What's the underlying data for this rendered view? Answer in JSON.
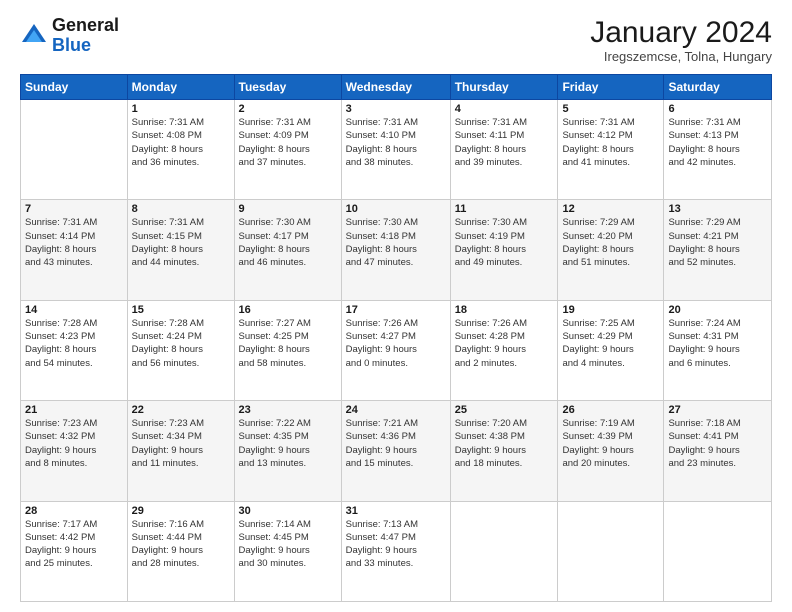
{
  "logo": {
    "general": "General",
    "blue": "Blue"
  },
  "header": {
    "month_year": "January 2024",
    "location": "Iregszemcse, Tolna, Hungary"
  },
  "days_of_week": [
    "Sunday",
    "Monday",
    "Tuesday",
    "Wednesday",
    "Thursday",
    "Friday",
    "Saturday"
  ],
  "weeks": [
    [
      {
        "day": "",
        "info": ""
      },
      {
        "day": "1",
        "info": "Sunrise: 7:31 AM\nSunset: 4:08 PM\nDaylight: 8 hours\nand 36 minutes."
      },
      {
        "day": "2",
        "info": "Sunrise: 7:31 AM\nSunset: 4:09 PM\nDaylight: 8 hours\nand 37 minutes."
      },
      {
        "day": "3",
        "info": "Sunrise: 7:31 AM\nSunset: 4:10 PM\nDaylight: 8 hours\nand 38 minutes."
      },
      {
        "day": "4",
        "info": "Sunrise: 7:31 AM\nSunset: 4:11 PM\nDaylight: 8 hours\nand 39 minutes."
      },
      {
        "day": "5",
        "info": "Sunrise: 7:31 AM\nSunset: 4:12 PM\nDaylight: 8 hours\nand 41 minutes."
      },
      {
        "day": "6",
        "info": "Sunrise: 7:31 AM\nSunset: 4:13 PM\nDaylight: 8 hours\nand 42 minutes."
      }
    ],
    [
      {
        "day": "7",
        "info": "Sunrise: 7:31 AM\nSunset: 4:14 PM\nDaylight: 8 hours\nand 43 minutes."
      },
      {
        "day": "8",
        "info": "Sunrise: 7:31 AM\nSunset: 4:15 PM\nDaylight: 8 hours\nand 44 minutes."
      },
      {
        "day": "9",
        "info": "Sunrise: 7:30 AM\nSunset: 4:17 PM\nDaylight: 8 hours\nand 46 minutes."
      },
      {
        "day": "10",
        "info": "Sunrise: 7:30 AM\nSunset: 4:18 PM\nDaylight: 8 hours\nand 47 minutes."
      },
      {
        "day": "11",
        "info": "Sunrise: 7:30 AM\nSunset: 4:19 PM\nDaylight: 8 hours\nand 49 minutes."
      },
      {
        "day": "12",
        "info": "Sunrise: 7:29 AM\nSunset: 4:20 PM\nDaylight: 8 hours\nand 51 minutes."
      },
      {
        "day": "13",
        "info": "Sunrise: 7:29 AM\nSunset: 4:21 PM\nDaylight: 8 hours\nand 52 minutes."
      }
    ],
    [
      {
        "day": "14",
        "info": "Sunrise: 7:28 AM\nSunset: 4:23 PM\nDaylight: 8 hours\nand 54 minutes."
      },
      {
        "day": "15",
        "info": "Sunrise: 7:28 AM\nSunset: 4:24 PM\nDaylight: 8 hours\nand 56 minutes."
      },
      {
        "day": "16",
        "info": "Sunrise: 7:27 AM\nSunset: 4:25 PM\nDaylight: 8 hours\nand 58 minutes."
      },
      {
        "day": "17",
        "info": "Sunrise: 7:26 AM\nSunset: 4:27 PM\nDaylight: 9 hours\nand 0 minutes."
      },
      {
        "day": "18",
        "info": "Sunrise: 7:26 AM\nSunset: 4:28 PM\nDaylight: 9 hours\nand 2 minutes."
      },
      {
        "day": "19",
        "info": "Sunrise: 7:25 AM\nSunset: 4:29 PM\nDaylight: 9 hours\nand 4 minutes."
      },
      {
        "day": "20",
        "info": "Sunrise: 7:24 AM\nSunset: 4:31 PM\nDaylight: 9 hours\nand 6 minutes."
      }
    ],
    [
      {
        "day": "21",
        "info": "Sunrise: 7:23 AM\nSunset: 4:32 PM\nDaylight: 9 hours\nand 8 minutes."
      },
      {
        "day": "22",
        "info": "Sunrise: 7:23 AM\nSunset: 4:34 PM\nDaylight: 9 hours\nand 11 minutes."
      },
      {
        "day": "23",
        "info": "Sunrise: 7:22 AM\nSunset: 4:35 PM\nDaylight: 9 hours\nand 13 minutes."
      },
      {
        "day": "24",
        "info": "Sunrise: 7:21 AM\nSunset: 4:36 PM\nDaylight: 9 hours\nand 15 minutes."
      },
      {
        "day": "25",
        "info": "Sunrise: 7:20 AM\nSunset: 4:38 PM\nDaylight: 9 hours\nand 18 minutes."
      },
      {
        "day": "26",
        "info": "Sunrise: 7:19 AM\nSunset: 4:39 PM\nDaylight: 9 hours\nand 20 minutes."
      },
      {
        "day": "27",
        "info": "Sunrise: 7:18 AM\nSunset: 4:41 PM\nDaylight: 9 hours\nand 23 minutes."
      }
    ],
    [
      {
        "day": "28",
        "info": "Sunrise: 7:17 AM\nSunset: 4:42 PM\nDaylight: 9 hours\nand 25 minutes."
      },
      {
        "day": "29",
        "info": "Sunrise: 7:16 AM\nSunset: 4:44 PM\nDaylight: 9 hours\nand 28 minutes."
      },
      {
        "day": "30",
        "info": "Sunrise: 7:14 AM\nSunset: 4:45 PM\nDaylight: 9 hours\nand 30 minutes."
      },
      {
        "day": "31",
        "info": "Sunrise: 7:13 AM\nSunset: 4:47 PM\nDaylight: 9 hours\nand 33 minutes."
      },
      {
        "day": "",
        "info": ""
      },
      {
        "day": "",
        "info": ""
      },
      {
        "day": "",
        "info": ""
      }
    ]
  ]
}
